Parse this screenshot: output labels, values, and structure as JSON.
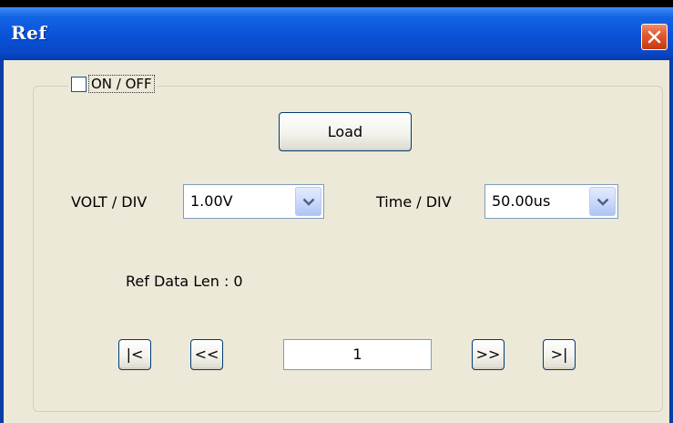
{
  "window": {
    "title": "Ref"
  },
  "toggle": {
    "label": "ON / OFF",
    "checked": false
  },
  "load_button": {
    "label": "Load"
  },
  "volt_div": {
    "label": "VOLT / DIV",
    "value": "1.00V"
  },
  "time_div": {
    "label": "Time / DIV",
    "value": "50.00us"
  },
  "ref_data": {
    "text": "Ref Data Len : 0"
  },
  "navigation": {
    "first_label": "|<",
    "prev_label": "<<",
    "page_value": "1",
    "next_label": ">>",
    "last_label": ">|"
  },
  "icons": {
    "close": "close-icon",
    "dropdown": "chevron-down-icon"
  },
  "colors": {
    "titlebar": "#0a52d8",
    "client_bg": "#ece9d8",
    "close_button": "#e25a30",
    "button_border": "#003c74"
  }
}
